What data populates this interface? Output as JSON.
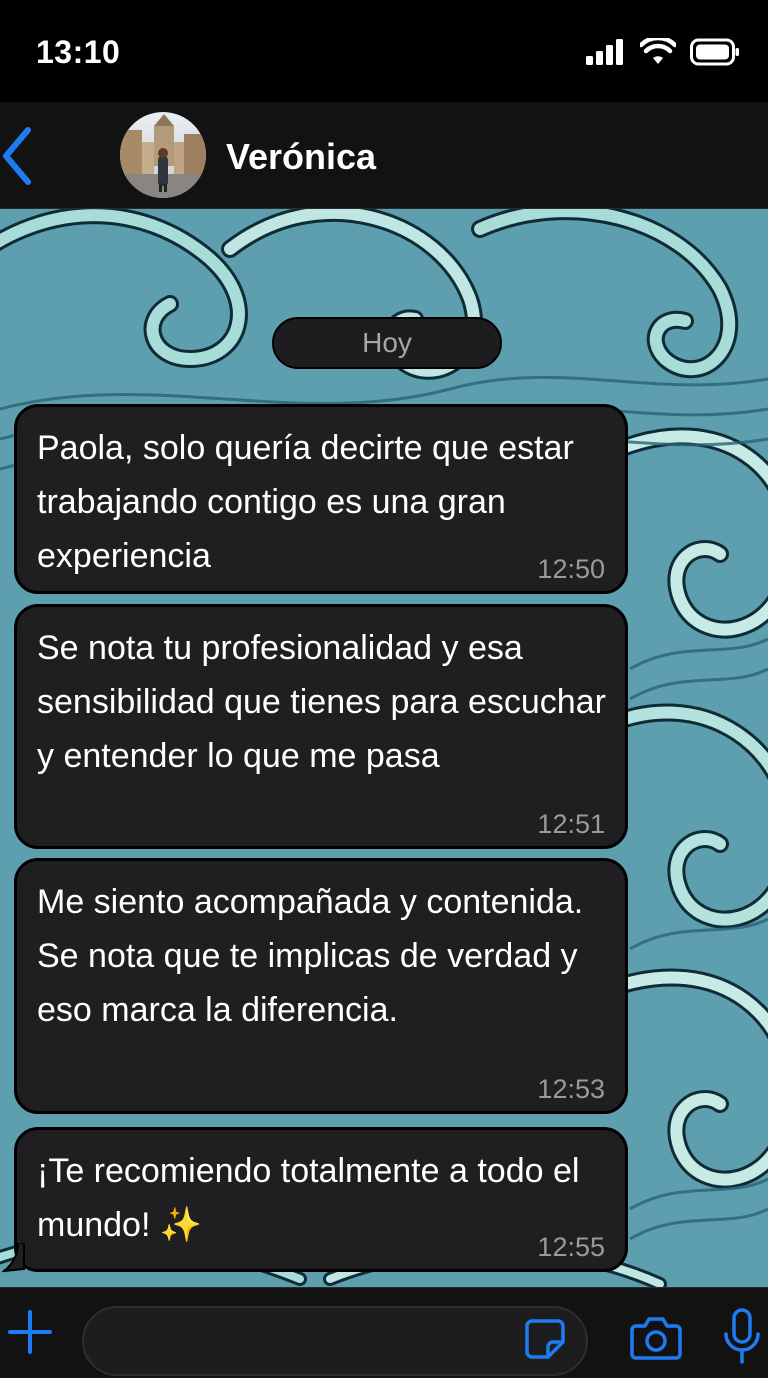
{
  "status_bar": {
    "time": "13:10",
    "icons": [
      "cellular-signal-icon",
      "wifi-icon",
      "battery-icon"
    ]
  },
  "header": {
    "back_icon": "chevron-left-icon",
    "contact_name": "Verónica",
    "avatar_icon": "contact-photo"
  },
  "chat": {
    "date_separator": "Hoy",
    "messages": [
      {
        "text": "Paola, solo quería decirte que estar trabajando contigo es una gran experiencia",
        "time": "12:50"
      },
      {
        "text": "Se nota tu profesionalidad y esa sensibilidad que tienes para escuchar y entender lo que me pasa",
        "time": "12:51"
      },
      {
        "text": "Me siento acompañada y contenida. Se nota que te implicas de verdad y eso marca la diferencia.",
        "time": "12:53"
      },
      {
        "text": "¡Te recomiendo totalmente a todo el mundo! ✨",
        "time": "12:55"
      }
    ]
  },
  "input_bar": {
    "placeholder": "",
    "icons": [
      "plus-icon",
      "sticker-icon",
      "camera-icon",
      "microphone-icon"
    ]
  },
  "colors": {
    "accent": "#1e7cf2",
    "bubble": "#1f1f21",
    "background": "#000000",
    "wallpaper": "#5d9fae"
  }
}
